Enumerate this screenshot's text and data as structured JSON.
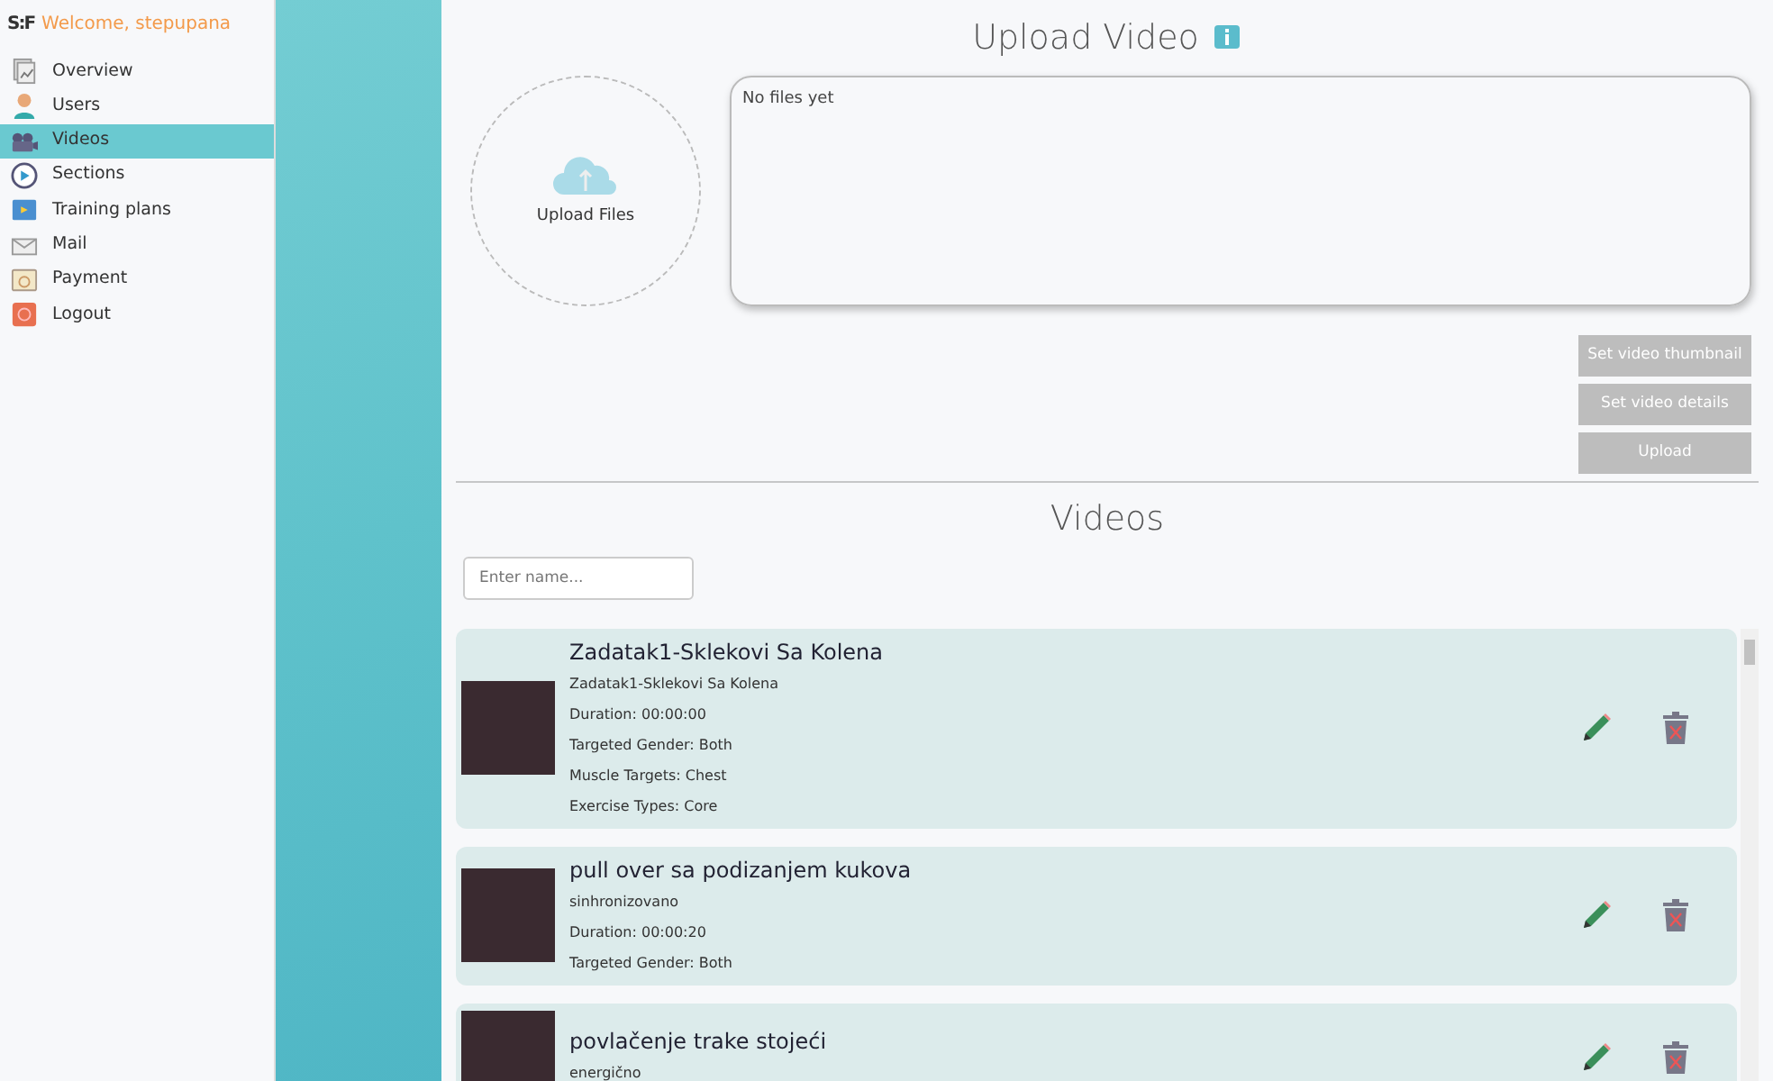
{
  "sidebar": {
    "welcome": "Welcome, stepupana",
    "logo": "S:F",
    "items": [
      {
        "label": "Overview",
        "selected": false
      },
      {
        "label": "Users",
        "selected": false
      },
      {
        "label": "Videos",
        "selected": true
      },
      {
        "label": "Sections",
        "selected": false
      },
      {
        "label": "Training plans",
        "selected": false
      },
      {
        "label": "Mail",
        "selected": false
      },
      {
        "label": "Payment",
        "selected": false
      },
      {
        "label": "Logout",
        "selected": false
      }
    ]
  },
  "upload": {
    "title": "Upload Video",
    "dropzone_label": "Upload Files",
    "files_text": "No files yet",
    "buttons": [
      {
        "label": "Set video thumbnail",
        "disabled": true
      },
      {
        "label": "Set video details",
        "disabled": true
      },
      {
        "label": "Upload",
        "disabled": true
      }
    ]
  },
  "videos": {
    "title": "Videos",
    "search": {
      "placeholder": "Enter name..."
    },
    "items": [
      {
        "title": "Zadatak1-Sklekovi Sa Kolena",
        "subtitle": "Zadatak1-Sklekovi Sa Kolena",
        "details": [
          "Duration: 00:00:00",
          "Targeted Gender: Both",
          "Muscle Targets: Chest",
          "Exercise Types: Core"
        ]
      },
      {
        "title": "pull over sa podizanjem kukova",
        "subtitle": "sinhronizovano",
        "details": [
          "Duration: 00:00:20",
          "Targeted Gender: Both"
        ]
      },
      {
        "title": "povlačenje trake stojeći",
        "subtitle": "energično"
      }
    ]
  }
}
